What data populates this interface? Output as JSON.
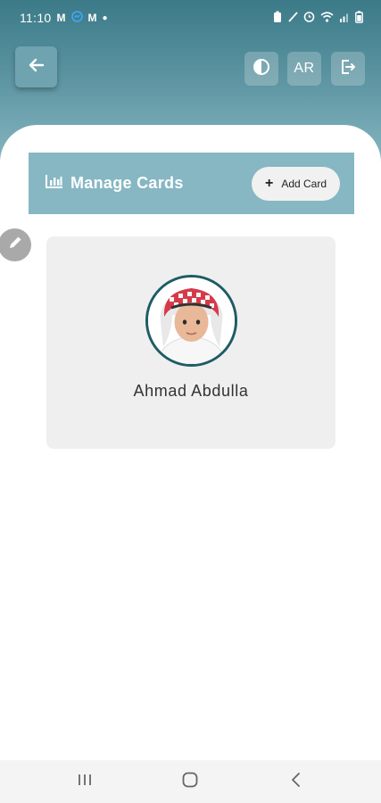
{
  "status_bar": {
    "time": "11:10",
    "notification_icons": [
      "gmail-icon",
      "messenger-icon",
      "gmail-icon"
    ],
    "right_icons": [
      "battery-saver-icon",
      "no-sim-icon",
      "alarm-icon",
      "wifi-icon",
      "signal-icon",
      "battery-icon"
    ]
  },
  "toolbar": {
    "back_icon": "arrow-left-icon",
    "contrast_icon": "contrast-icon",
    "language_label": "AR",
    "logout_icon": "logout-icon"
  },
  "title_bar": {
    "icon": "bar-chart-icon",
    "title": "Manage Cards",
    "add_button_label": "Add Card"
  },
  "cards": [
    {
      "name": "Ahmad Abdulla"
    }
  ],
  "colors": {
    "header": "#3b7a88",
    "title_bar": "#86b7c3",
    "avatar_ring": "#1e5c66",
    "card_bg": "#efefef"
  }
}
